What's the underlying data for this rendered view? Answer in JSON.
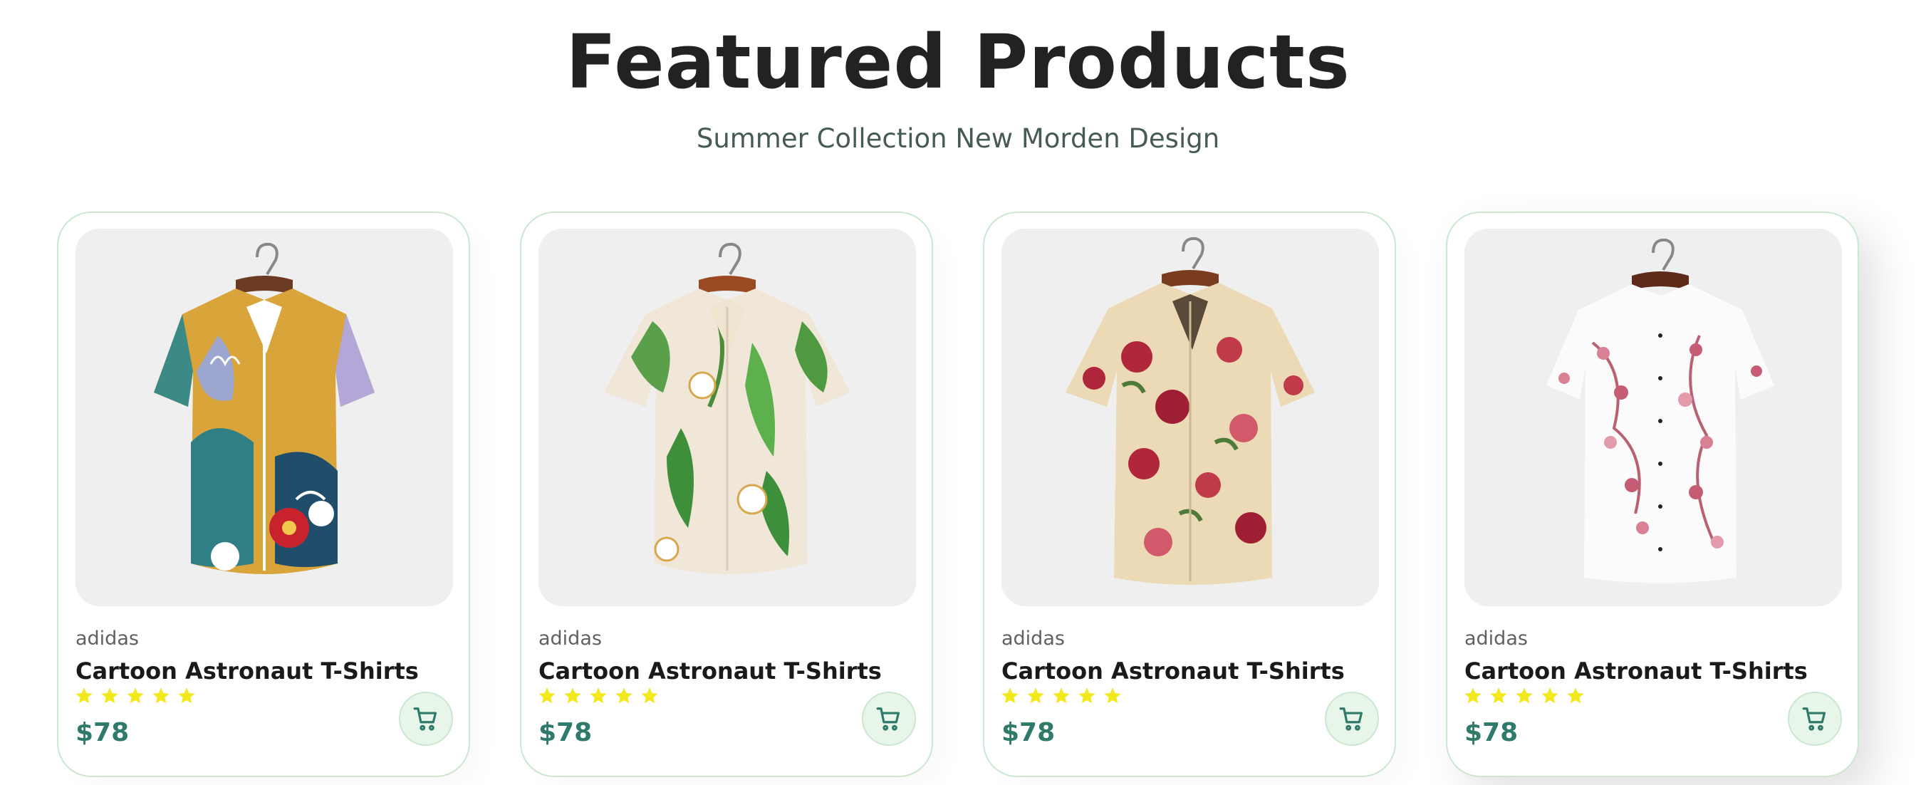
{
  "section": {
    "title": "Featured Products",
    "subtitle": "Summer Collection New Morden Design"
  },
  "colors": {
    "accent": "#2f7a6a",
    "card_border": "#cce7d0",
    "star": "#f3e71e",
    "cart_bg": "#e8f6ea"
  },
  "products": [
    {
      "brand": "adidas",
      "name": "Cartoon Astronaut T-Shirts",
      "rating": 5,
      "price": "$78",
      "image": "shirt-abstract-pattern",
      "cart_icon": "cart-icon"
    },
    {
      "brand": "adidas",
      "name": "Cartoon Astronaut T-Shirts",
      "rating": 5,
      "price": "$78",
      "image": "shirt-leaf-pattern",
      "cart_icon": "cart-icon"
    },
    {
      "brand": "adidas",
      "name": "Cartoon Astronaut T-Shirts",
      "rating": 5,
      "price": "$78",
      "image": "shirt-rose-pattern",
      "cart_icon": "cart-icon"
    },
    {
      "brand": "adidas",
      "name": "Cartoon Astronaut T-Shirts",
      "rating": 5,
      "price": "$78",
      "image": "shirt-blossom-pattern",
      "cart_icon": "cart-icon"
    }
  ]
}
